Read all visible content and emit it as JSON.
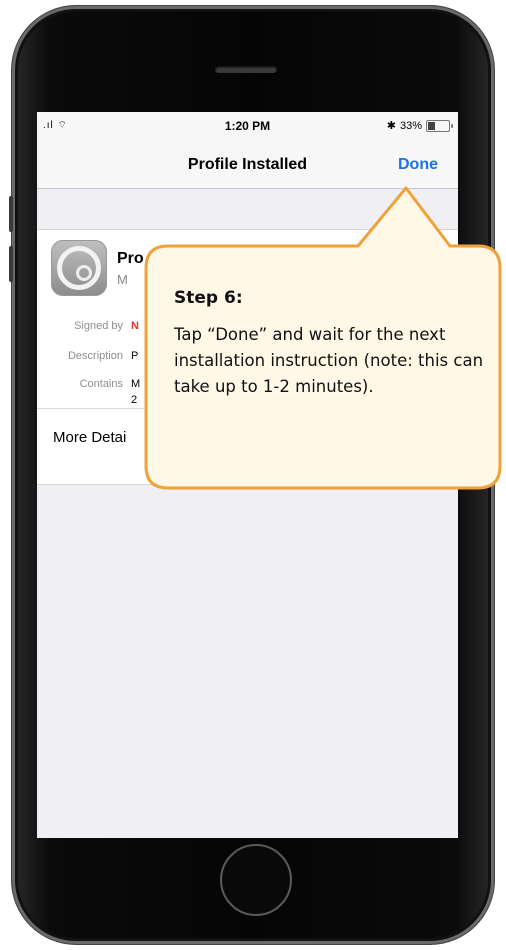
{
  "status_bar": {
    "signal": ".ıl",
    "time": "1:20 PM",
    "bluetooth": "✱",
    "battery_percent_label": "33%",
    "battery_level": 0.33
  },
  "nav": {
    "title": "Profile Installed",
    "done_label": "Done"
  },
  "profile": {
    "icon": "settings-gear-icon",
    "name_partial": "Pro",
    "subtitle_partial": "M"
  },
  "details": [
    {
      "label": "Signed by",
      "value": "N"
    },
    {
      "label": "Description",
      "value": "P"
    },
    {
      "label": "Contains",
      "value": "M"
    },
    {
      "label": "",
      "value": "2"
    }
  ],
  "more_details_label": "More Detai",
  "callout": {
    "title": "Step 6:",
    "body": "Tap “Done” and wait for the next installation instruction (note: this can take up to 1-2 minutes).",
    "border_color": "#f0a23a",
    "fill_color": "#fff8e7"
  }
}
